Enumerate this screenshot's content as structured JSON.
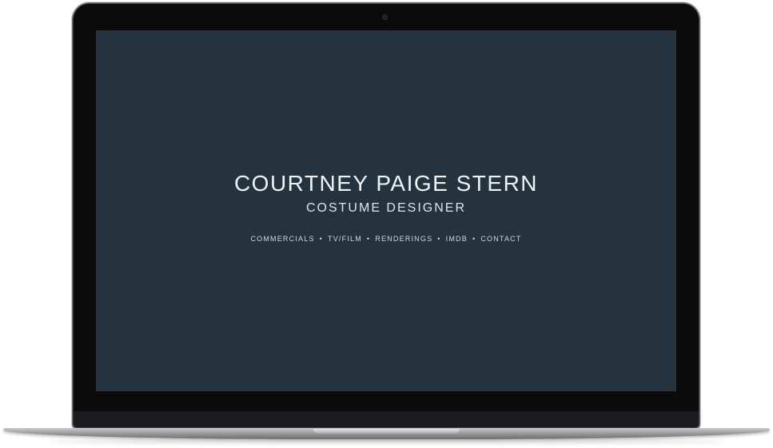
{
  "site": {
    "title": "COURTNEY PAIGE STERN",
    "subtitle": "COSTUME DESIGNER"
  },
  "nav": {
    "items": [
      {
        "label": "COMMERCIALS"
      },
      {
        "label": "TV/FILM"
      },
      {
        "label": "RENDERINGS"
      },
      {
        "label": "IMDB"
      },
      {
        "label": "CONTACT"
      }
    ],
    "separator": "•"
  },
  "colors": {
    "screen_background": "#25333f",
    "text_primary": "#f1f4f6",
    "text_secondary": "#cfd8df",
    "bezel": "#0b0b0c",
    "laptop_body": "#8f8f93"
  }
}
